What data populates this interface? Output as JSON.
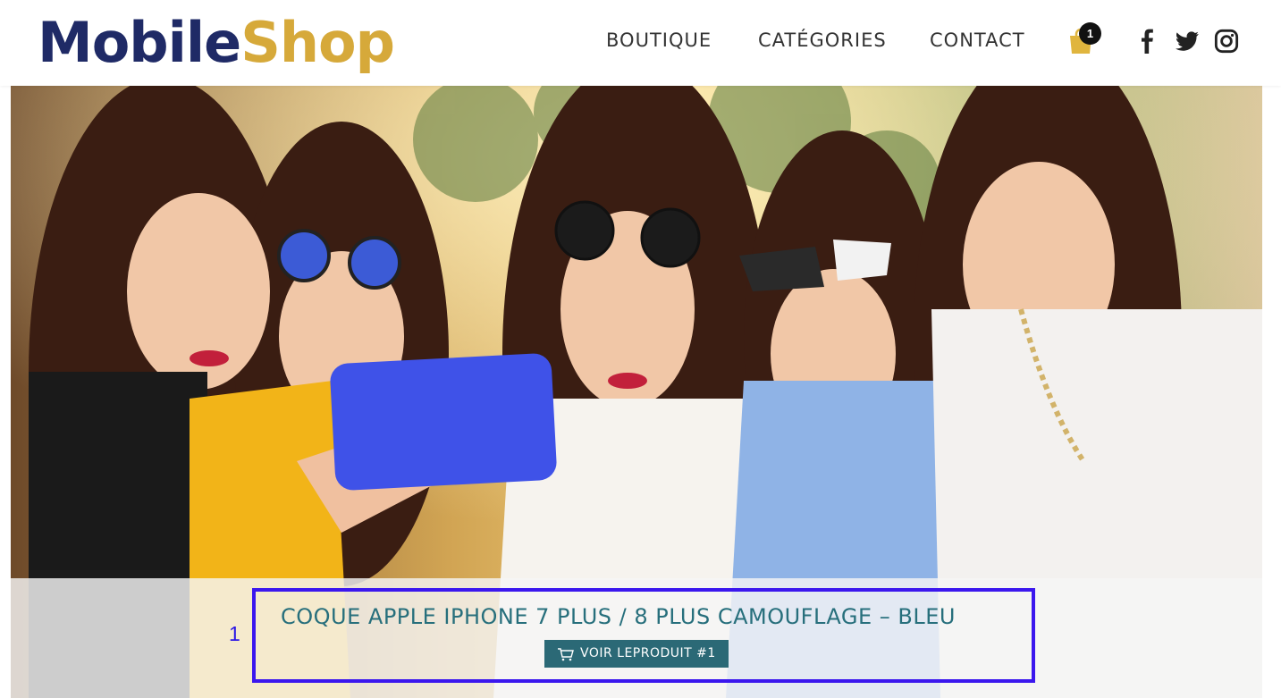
{
  "header": {
    "logo": {
      "part1": "Mobile",
      "part2": "Shop"
    },
    "nav": [
      {
        "label": "BOUTIQUE"
      },
      {
        "label": "CATÉGORIES"
      },
      {
        "label": "CONTACT"
      }
    ],
    "cart": {
      "icon": "shopping-bag-icon",
      "count": "1"
    },
    "social": [
      {
        "icon": "facebook-icon"
      },
      {
        "icon": "twitter-icon"
      },
      {
        "icon": "instagram-icon"
      }
    ]
  },
  "hero": {
    "image": "group-selfie-photo",
    "slide_index": "1",
    "product_title": "COQUE APPLE IPHONE 7 PLUS / 8 PLUS CAMOUFLAGE – BLEU",
    "cta_label": "VOIR LEPRODUIT #1"
  },
  "colors": {
    "brand_dark": "#1f2a66",
    "brand_gold": "#d6a93a",
    "accent_teal": "#2b6976",
    "highlight": "#3b17ee"
  }
}
